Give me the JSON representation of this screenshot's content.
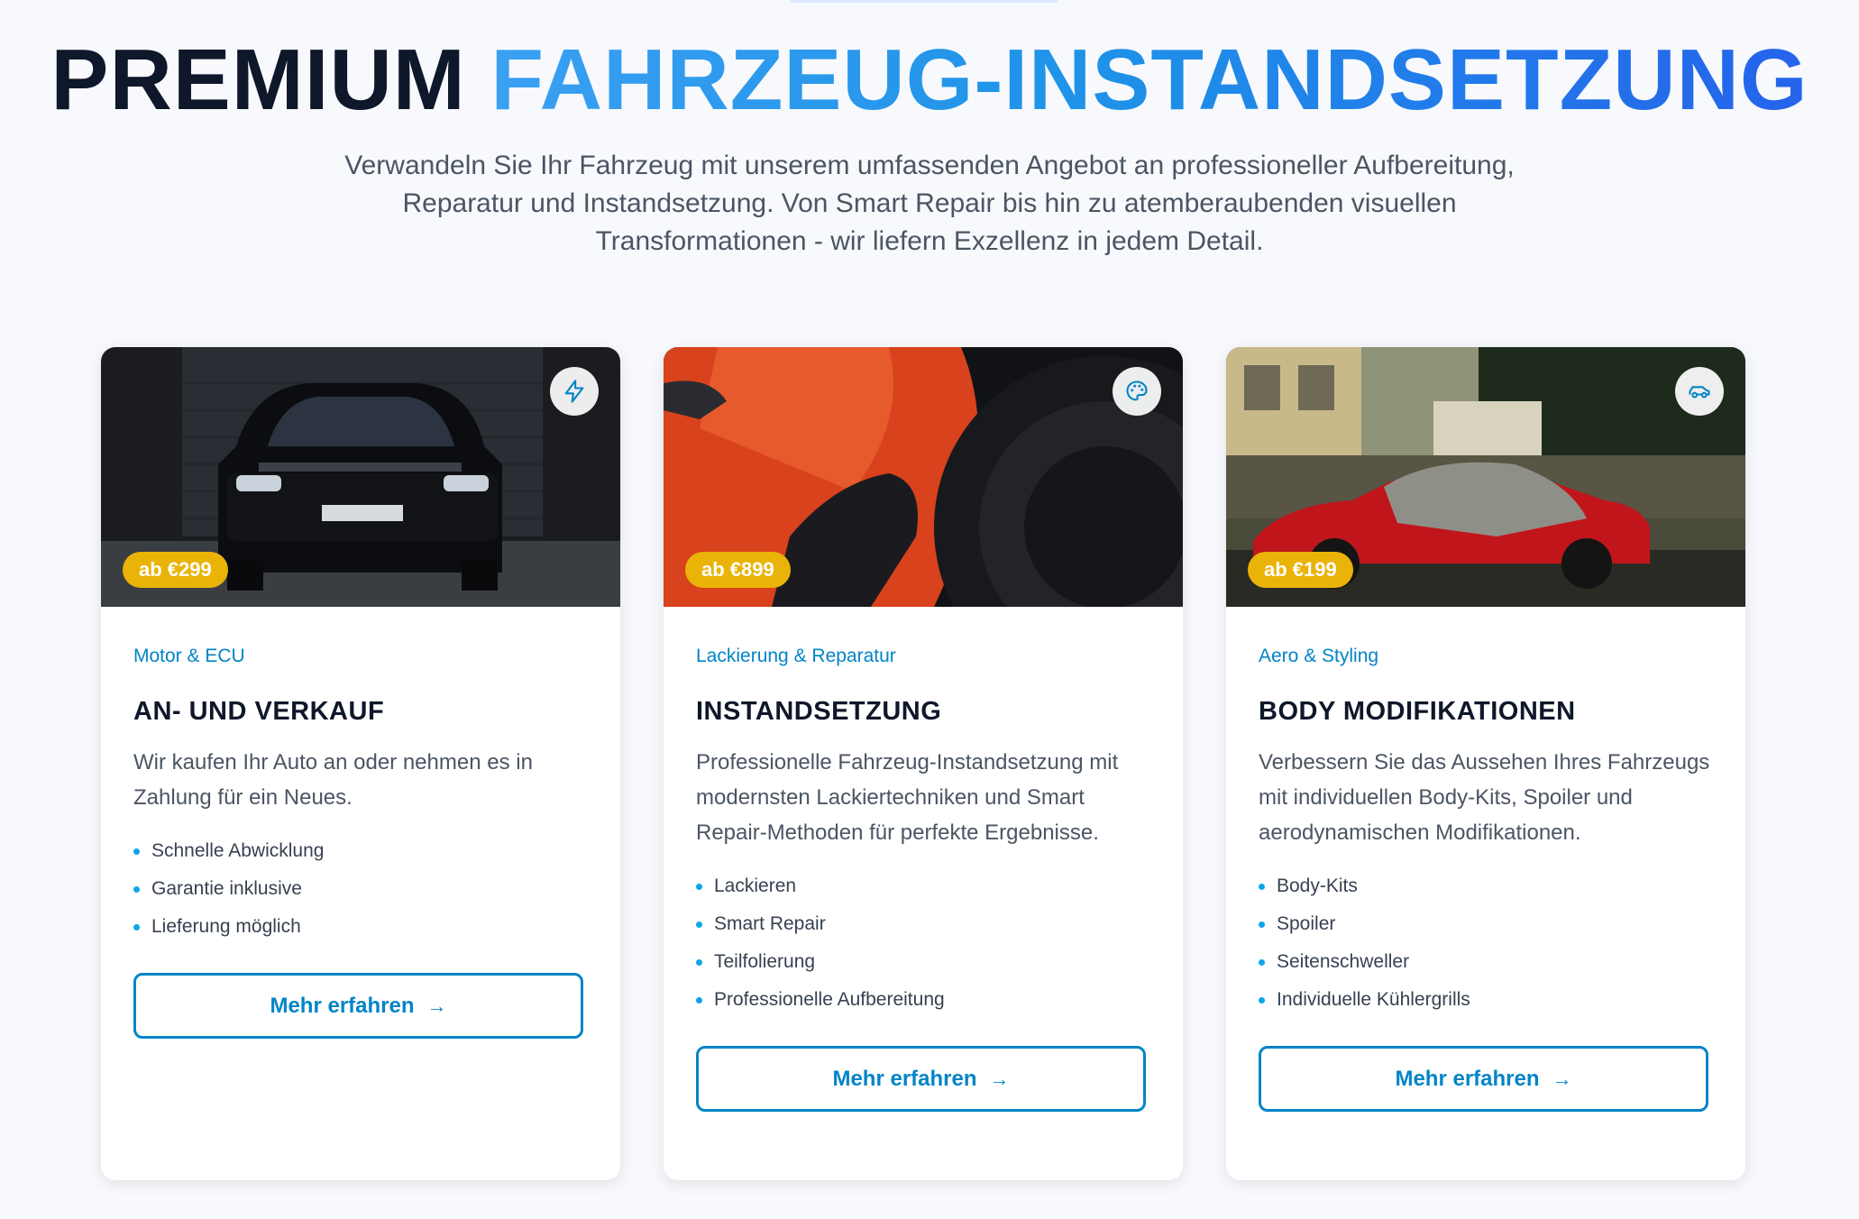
{
  "hero": {
    "title_dark": "PREMIUM",
    "title_accent": "FAHRZEUG-INSTANDSETZUNG",
    "subtitle": "Verwandeln Sie Ihr Fahrzeug mit unserem umfassenden Angebot an professioneller Aufbereitung, Reparatur und Instandsetzung. Von Smart Repair bis hin zu atemberaubenden visuellen Transformationen - wir liefern Exzellenz in jedem Detail."
  },
  "colors": {
    "accent": "#0284c7",
    "price_badge": "#eab308",
    "heading": "#0f172a"
  },
  "cards": [
    {
      "icon": "lightning-icon",
      "price": "ab €299",
      "category": "Motor & ECU",
      "title": "AN- UND VERKAUF",
      "description": "Wir kaufen Ihr Auto an oder nehmen es in Zahlung für ein Neues.",
      "features": [
        "Schnelle Abwicklung",
        "Garantie inklusive",
        "Lieferung möglich"
      ],
      "button": "Mehr erfahren"
    },
    {
      "icon": "palette-icon",
      "price": "ab €899",
      "category": "Lackierung & Reparatur",
      "title": "INSTANDSETZUNG",
      "description": "Professionelle Fahrzeug-Instandsetzung mit modernsten Lackiertechniken und Smart Repair-Methoden für perfekte Ergebnisse.",
      "features": [
        "Lackieren",
        "Smart Repair",
        "Teilfolierung",
        "Professionelle Aufbereitung"
      ],
      "button": "Mehr erfahren"
    },
    {
      "icon": "car-icon",
      "price": "ab €199",
      "category": "Aero & Styling",
      "title": "BODY MODIFIKATIONEN",
      "description": "Verbessern Sie das Aussehen Ihres Fahrzeugs mit individuellen Body-Kits, Spoiler und aerodynamischen Modifikationen.",
      "features": [
        "Body-Kits",
        "Spoiler",
        "Seitenschweller",
        "Individuelle Kühlergrills"
      ],
      "button": "Mehr erfahren"
    }
  ]
}
